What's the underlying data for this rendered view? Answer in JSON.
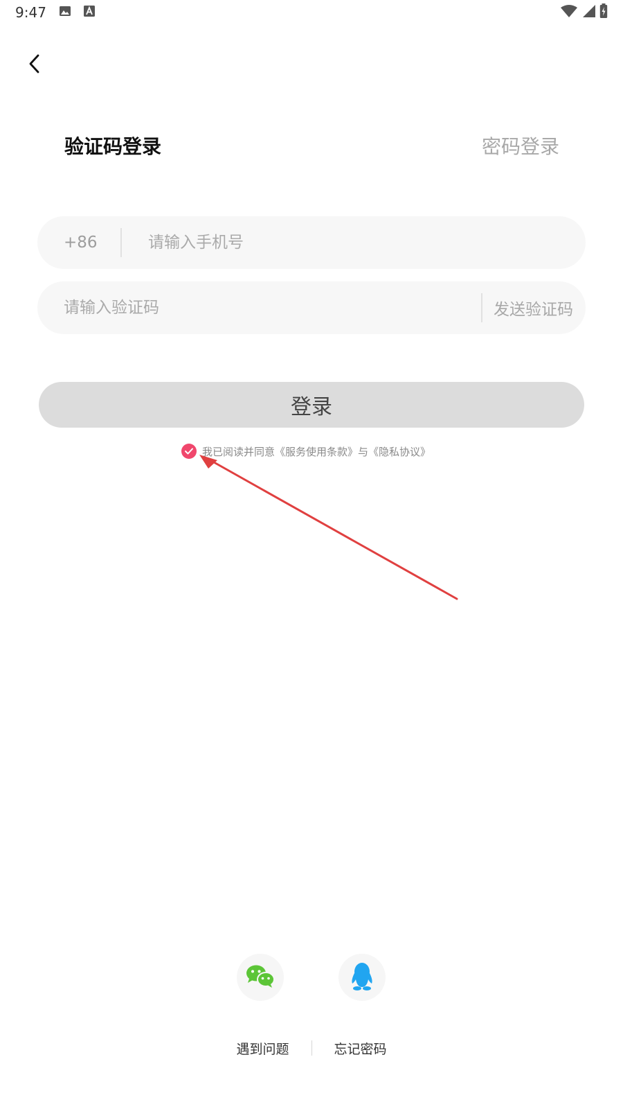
{
  "status_bar": {
    "time": "9:47",
    "icons": [
      "image-icon",
      "font-icon",
      "wifi-icon",
      "signal-icon",
      "battery-charging-icon"
    ]
  },
  "header": {
    "back_icon": "chevron-left-icon"
  },
  "tabs": {
    "active_label": "验证码登录",
    "inactive_label": "密码登录"
  },
  "form": {
    "country_code": "+86",
    "phone_placeholder": "请输入手机号",
    "phone_value": "",
    "code_placeholder": "请输入验证码",
    "code_value": "",
    "send_code_label": "发送验证码",
    "login_label": "登录"
  },
  "agreement": {
    "checked": true,
    "text": "我已阅读并同意《服务使用条款》与《隐私协议》"
  },
  "social_login": {
    "wechat_icon": "wechat-icon",
    "qq_icon": "qq-icon"
  },
  "links": {
    "problem_label": "遇到问题",
    "forgot_label": "忘记密码"
  },
  "colors": {
    "accent": "#f0476c",
    "annotation": "#e04040",
    "wechat": "#5cc537",
    "qq": "#21a5f0"
  }
}
